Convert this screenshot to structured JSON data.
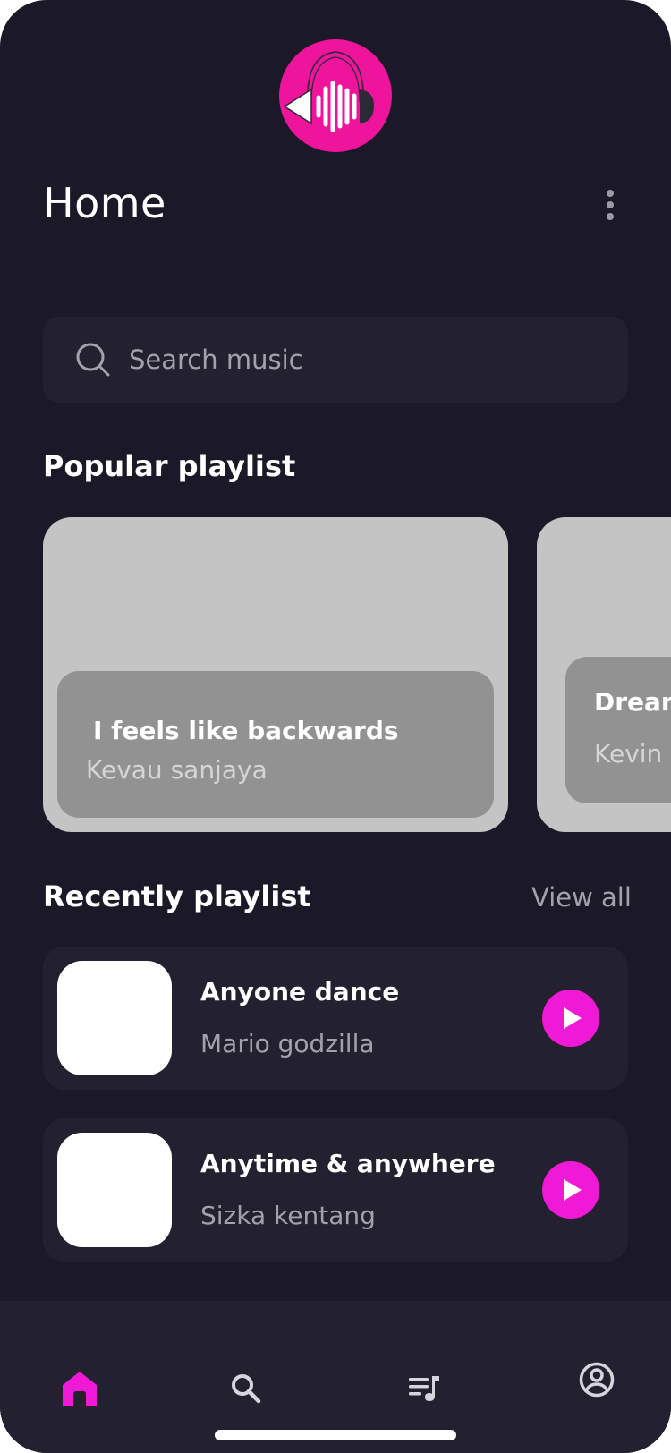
{
  "header": {
    "title": "Home",
    "logo_icon": "headphones-music-logo-icon",
    "more_icon": "more-vertical-icon"
  },
  "search": {
    "placeholder": "Search music",
    "value": "",
    "icon": "search-icon"
  },
  "popular": {
    "section_title": "Popular playlist",
    "cards": [
      {
        "title": "I feels like backwards",
        "artist": "Kevau sanjaya"
      },
      {
        "title": "Dream",
        "artist": "Kevin s"
      }
    ]
  },
  "recent": {
    "section_title": "Recently playlist",
    "view_all_label": "View all",
    "items": [
      {
        "title": "Anyone dance",
        "artist": "Mario godzilla"
      },
      {
        "title": "Anytime & anywhere",
        "artist": "Sizka kentang"
      }
    ]
  },
  "nav": {
    "items": [
      {
        "icon": "home-icon",
        "active": true
      },
      {
        "icon": "search-icon",
        "active": false
      },
      {
        "icon": "playlist-icon",
        "active": false
      },
      {
        "icon": "account-icon",
        "active": false
      }
    ]
  },
  "colors": {
    "background": "#1b1928",
    "surface": "#23212f",
    "accent": "#f01ad6",
    "logo": "#ee149c",
    "muted_text": "#a4a1ad"
  }
}
